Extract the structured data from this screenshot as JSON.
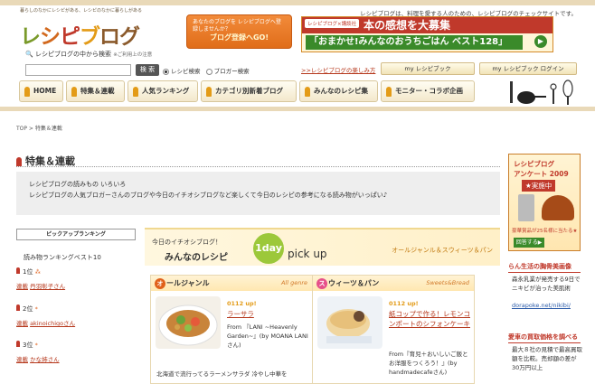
{
  "header": {
    "slogan": "暮らしのなかにレシピがある、レシピのなかに暮らしがある",
    "tagline": "レシピブログは、料理を愛する人のための、レシピブログのチェックサイトです。",
    "logo": [
      "レ",
      "シ",
      "ピ",
      "ブ",
      "ログ"
    ],
    "promo_text": "あなたのブログを レシピブログへ登録しませんか？",
    "promo_cta": "ブログ登録へGO!",
    "banner_label": "レシピブログ×講談社",
    "banner_title": "本の感想を大募集",
    "banner_sub": "「おまかせ!みんなのおうちごはん ベスト128」",
    "banner_arrow": "▶"
  },
  "search": {
    "label": "レシピブログの中から検索",
    "note": "※ご利用上の注意",
    "button": "検 索",
    "radio1": "レシピ検索",
    "radio2": "ブロガー検索",
    "fun_link": ">>レシピブログの楽しみ方",
    "mybook": "my レシピブック",
    "login": "my レシピブック ログイン"
  },
  "nav": [
    "HOME",
    "特集＆連載",
    "人気ランキング",
    "カテゴリ別新着ブログ",
    "みんなのレシピ集",
    "モニター・コラボ企画"
  ],
  "breadcrumb": "TOP > 特集＆連載",
  "section_title": "特集＆連載",
  "intro": {
    "line1": "レシピブログの読みもの いろいろ",
    "line2": "レシピブログの人気ブロガーさんのブログや今日のイチオシブログなど楽しくて今日のレシピの参考になる読み物がいっぱい♪"
  },
  "ranking": {
    "header": "ピックアップランキング",
    "title": "読み物ランキングベスト10",
    "items": [
      {
        "rank": "1位",
        "stars": "⁂",
        "label": "連載",
        "name": "丹羽彰子さん"
      },
      {
        "rank": "2位",
        "stars": "*",
        "label": "連載",
        "name": "akinoichigoさん"
      },
      {
        "rank": "3位",
        "stars": "*",
        "label": "連載",
        "name": "かな姉さん"
      }
    ]
  },
  "pickup": {
    "line1": "今日のイチオシブログ！",
    "line2": "みんなのレシピ",
    "day": "1day",
    "pick": "pick up",
    "cat": "オールジャンル＆スウィーツ＆パン"
  },
  "cards": [
    {
      "head": "オールジャンル",
      "circle": "オ",
      "head_rest": "ールジャンル",
      "en": "All genre",
      "date": "0112 up!",
      "title": "ラーサラ",
      "by": "From 『LANI ~Heavenly Garden~』(by MOANA LANIさん)",
      "text": "北海道で流行ってるラーメンサラダ 冷やし中華を"
    },
    {
      "head": "スウィーツ＆パン",
      "circle": "ス",
      "head_rest": "ウィーツ＆パン",
      "en": "Sweets&Bread",
      "date": "0112 up!",
      "title": "紙コップで作る！レモンコンポートのシフォンケーキ",
      "by": "From『育児＋おいしいご飯とお洋服をつくろう！』(by handmadecafeさん)",
      "text": ""
    }
  ],
  "right": {
    "enq1": "レシピブログ",
    "enq2": "アンケート 2009",
    "enq3": "★実施中",
    "enq4": "豪華賞品が25名様に当たる★",
    "enq_go": "回答する▶",
    "news_head": "らん生活の胸骨美画像",
    "news_text": "森永乳業が発売する9日でニキビが治った美肌術",
    "news_link": "dorapoke.net/nikibi/",
    "news2_head": "愛車の買取価格を調べる",
    "news2_text": "最大８社の見積で最高買取額を比較。売却額の差が 30万円以上"
  },
  "colors": {
    "accent": "#c0392b",
    "brand_orange": "#e39b17",
    "green": "#3a8a2a"
  }
}
